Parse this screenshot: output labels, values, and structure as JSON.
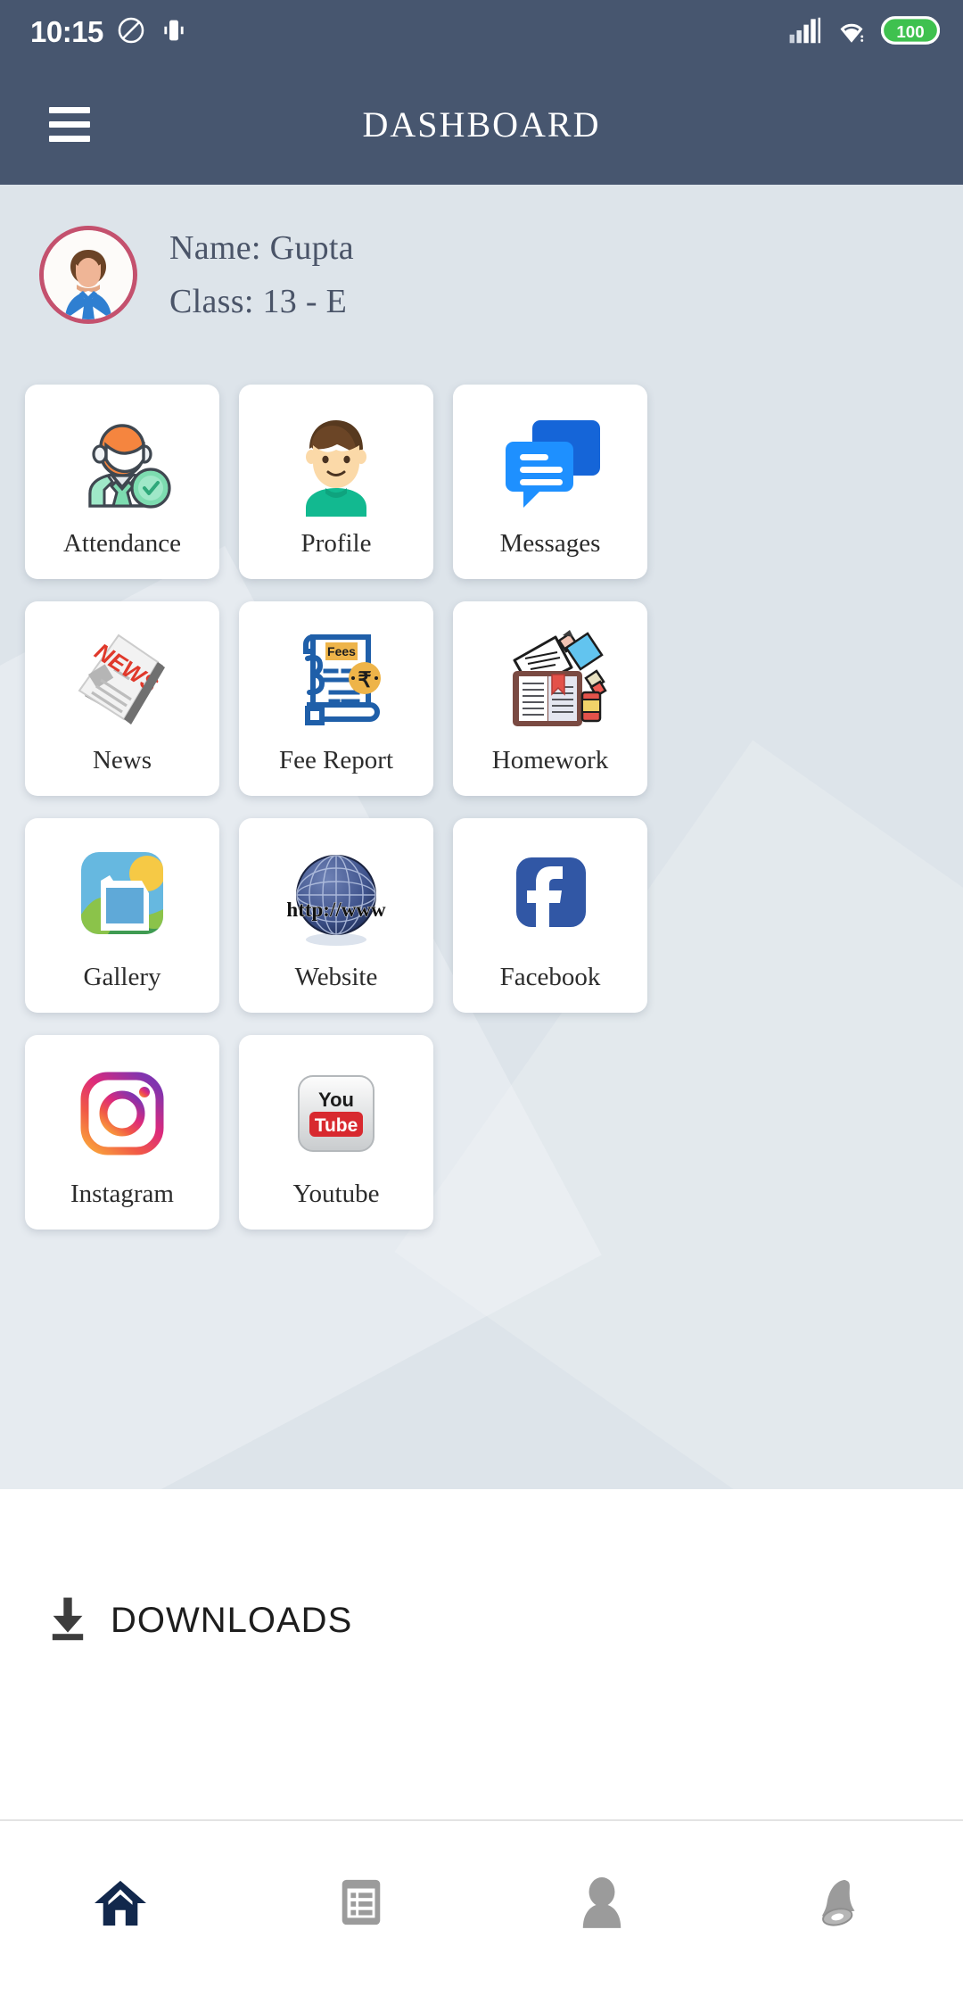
{
  "status_bar": {
    "time": "10:15",
    "icons_left": [
      "do-not-disturb-icon",
      "vibrate-mode-icon"
    ],
    "icons_right": [
      "signal-bars-icon",
      "wifi-icon",
      "battery-icon"
    ],
    "battery_level": "100"
  },
  "app_bar": {
    "title": "DASHBOARD",
    "menu_icon": "hamburger-menu-icon",
    "background_color": "#47566f"
  },
  "profile": {
    "avatar_icon": "user-avatar",
    "name_line": "Name: Gupta",
    "class_line": "Class: 13 - E"
  },
  "tiles": [
    {
      "label": "Attendance",
      "icon": "attendance-icon"
    },
    {
      "label": "Profile",
      "icon": "profile-icon"
    },
    {
      "label": "Messages",
      "icon": "messages-icon"
    },
    {
      "label": "News",
      "icon": "news-icon"
    },
    {
      "label": "Fee Report",
      "icon": "fee-report-icon"
    },
    {
      "label": "Homework",
      "icon": "homework-icon"
    },
    {
      "label": "Gallery",
      "icon": "gallery-icon"
    },
    {
      "label": "Website",
      "icon": "website-icon"
    },
    {
      "label": "Facebook",
      "icon": "facebook-icon"
    },
    {
      "label": "Instagram",
      "icon": "instagram-icon"
    },
    {
      "label": "Youtube",
      "icon": "youtube-icon"
    }
  ],
  "tile_inner_text": {
    "news_headline": "NEWS",
    "fees_badge": "Fees",
    "rupee_symbol": "₹",
    "website_url": "http://www",
    "facebook_glyph": "f",
    "youtube_top": "You",
    "youtube_bottom": "Tube"
  },
  "downloads": {
    "label": "DOWNLOADS",
    "icon": "download-arrow-icon"
  },
  "bottom_nav": {
    "items": [
      {
        "name": "home",
        "icon": "home-icon",
        "active": true
      },
      {
        "name": "list",
        "icon": "list-icon",
        "active": false
      },
      {
        "name": "account",
        "icon": "person-icon",
        "active": false
      },
      {
        "name": "notifications",
        "icon": "bell-icon",
        "active": false
      }
    ],
    "active_color": "#12284c",
    "inactive_color": "#9b9b9b"
  },
  "colors": {
    "header": "#47566f",
    "page_background": "#dde4ea",
    "card": "#ffffff",
    "avatar_ring": "#c4516e",
    "battery_green": "#3fc14f"
  }
}
